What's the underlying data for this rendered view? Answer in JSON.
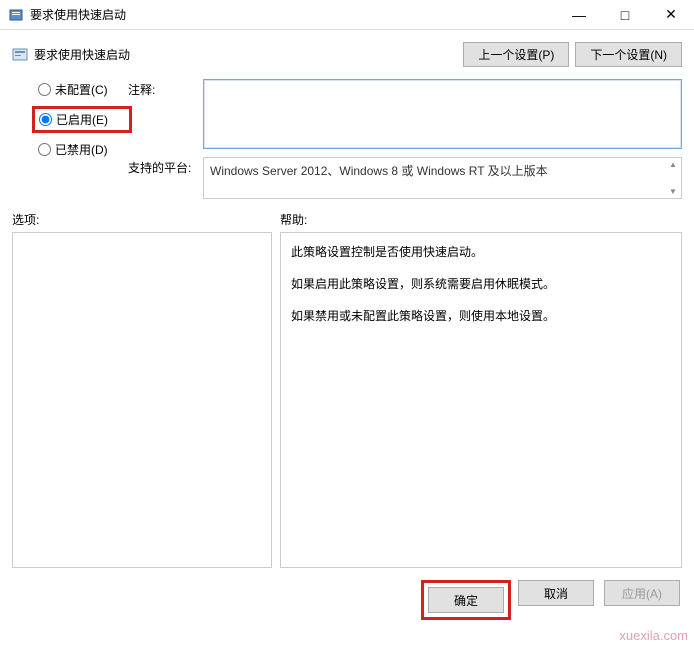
{
  "window": {
    "title": "要求使用快速启动",
    "minimize": "—",
    "maximize": "□",
    "close": "✕"
  },
  "header": {
    "title": "要求使用快速启动",
    "prev_btn": "上一个设置(P)",
    "next_btn": "下一个设置(N)"
  },
  "radios": {
    "not_configured": "未配置(C)",
    "enabled": "已启用(E)",
    "disabled": "已禁用(D)"
  },
  "fields": {
    "comment_label": "注释:",
    "comment_value": "",
    "platform_label": "支持的平台:",
    "platform_value": "Windows Server 2012、Windows 8 或 Windows RT 及以上版本"
  },
  "labels": {
    "options": "选项:",
    "help": "帮助:"
  },
  "help_text": {
    "p1": "此策略设置控制是否使用快速启动。",
    "p2": "如果启用此策略设置，则系统需要启用休眠模式。",
    "p3": "如果禁用或未配置此策略设置，则使用本地设置。"
  },
  "footer": {
    "ok": "确定",
    "cancel": "取消",
    "apply": "应用(A)"
  },
  "watermark": "xuexila.com"
}
